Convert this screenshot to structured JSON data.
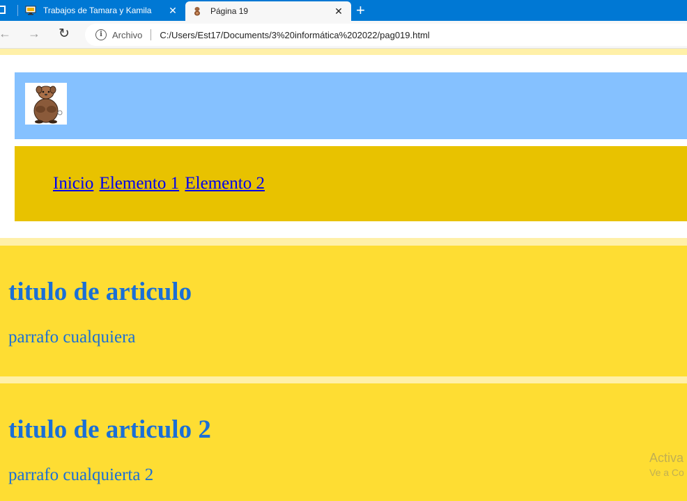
{
  "browser": {
    "tabs": [
      {
        "title": "Trabajos de Tamara y Kamila",
        "active": false
      },
      {
        "title": "Página 19",
        "active": true
      }
    ],
    "address": {
      "scheme_label": "Archivo",
      "url": "C:/Users/Est17/Documents/3%20informática%202022/pag019.html"
    }
  },
  "page": {
    "nav_links": [
      "Inicio",
      "Elemento 1",
      "Elemento 2"
    ],
    "articles": [
      {
        "title": "titulo de articulo",
        "paragraph": "parrafo cualquiera"
      },
      {
        "title": "titulo de articulo 2",
        "paragraph": "parrafo cualquierta 2"
      }
    ],
    "watermark": {
      "line1": "Activa",
      "line2": "Ve a Co"
    }
  },
  "colors": {
    "page_bg": "#fff0a8",
    "logo_bar": "#85c1ff",
    "nav_bar": "#e8c200",
    "article_bg": "#fedd33",
    "article_text": "#1a6fd6",
    "link": "#0000ee"
  }
}
